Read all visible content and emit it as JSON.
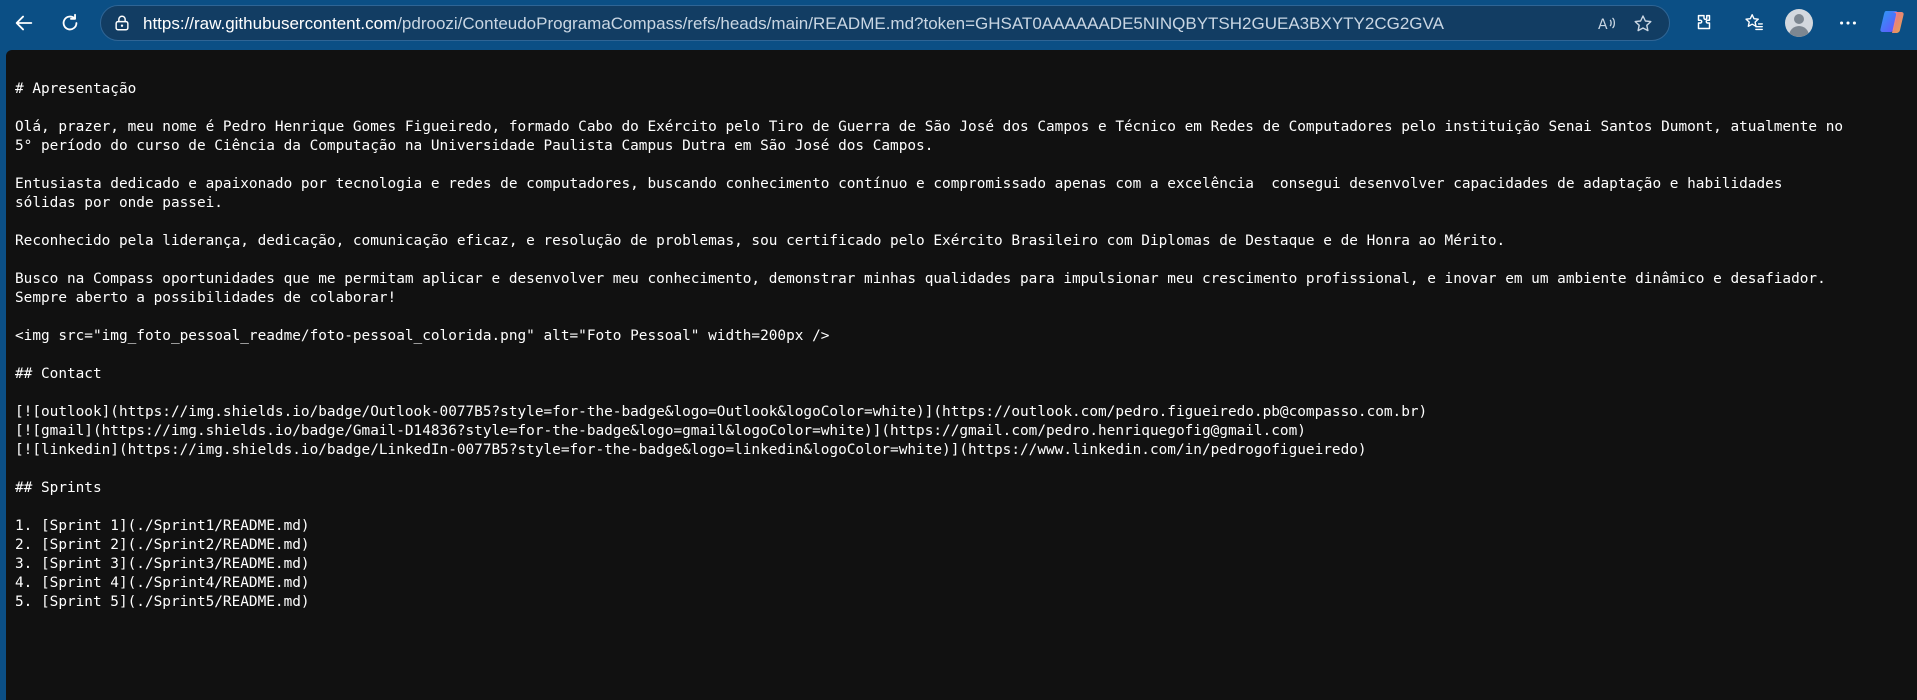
{
  "browser": {
    "url_host": "https://raw.githubusercontent.com",
    "url_path": "/pdroozi/ConteudoProgramaCompass/refs/heads/main/README.md?token=GHSAT0AAAAAADE5NINQBYTSH2GUEA3BXYTY2CG2GVA",
    "icons": {
      "back": "back-arrow-icon",
      "refresh": "refresh-icon",
      "lock": "lock-icon",
      "read_aloud": "read-aloud-icon",
      "favorite": "star-icon",
      "extensions": "puzzle-icon",
      "favorites": "favorites-icon",
      "profile": "avatar",
      "more": "more-icon",
      "copilot": "copilot-icon"
    },
    "colors": {
      "toolbar": "#0b4f85",
      "page": "#111111",
      "text": "#ffffff"
    }
  },
  "document": {
    "lines": [
      "# Apresentação",
      "",
      "Olá, prazer, meu nome é Pedro Henrique Gomes Figueiredo, formado Cabo do Exército pelo Tiro de Guerra de São José dos Campos e Técnico em Redes de Computadores pelo instituição Senai Santos Dumont, atualmente no",
      "5° período do curso de Ciência da Computação na Universidade Paulista Campus Dutra em São José dos Campos.",
      "",
      "Entusiasta dedicado e apaixonado por tecnologia e redes de computadores, buscando conhecimento contínuo e compromissado apenas com a excelência  consegui desenvolver capacidades de adaptação e habilidades",
      "sólidas por onde passei.",
      "",
      "Reconhecido pela liderança, dedicação, comunicação eficaz, e resolução de problemas, sou certificado pelo Exército Brasileiro com Diplomas de Destaque e de Honra ao Mérito.",
      "",
      "Busco na Compass oportunidades que me permitam aplicar e desenvolver meu conhecimento, demonstrar minhas qualidades para impulsionar meu crescimento profissional, e inovar em um ambiente dinâmico e desafiador.",
      "Sempre aberto a possibilidades de colaborar!",
      "",
      "<img src=\"img_foto_pessoal_readme/foto-pessoal_colorida.png\" alt=\"Foto Pessoal\" width=200px />",
      "",
      "## Contact",
      "",
      "[![outlook](https://img.shields.io/badge/Outlook-0077B5?style=for-the-badge&logo=Outlook&logoColor=white)](https://outlook.com/pedro.figueiredo.pb@compasso.com.br)",
      "[![gmail](https://img.shields.io/badge/Gmail-D14836?style=for-the-badge&logo=gmail&logoColor=white)](https://gmail.com/pedro.henriquegofig@gmail.com)",
      "[![linkedin](https://img.shields.io/badge/LinkedIn-0077B5?style=for-the-badge&logo=linkedin&logoColor=white)](https://www.linkedin.com/in/pedrogofigueiredo)",
      "",
      "## Sprints",
      "",
      "1. [Sprint 1](./Sprint1/README.md)",
      "2. [Sprint 2](./Sprint2/README.md)",
      "3. [Sprint 3](./Sprint3/README.md)",
      "4. [Sprint 4](./Sprint4/README.md)",
      "5. [Sprint 5](./Sprint5/README.md)"
    ]
  }
}
